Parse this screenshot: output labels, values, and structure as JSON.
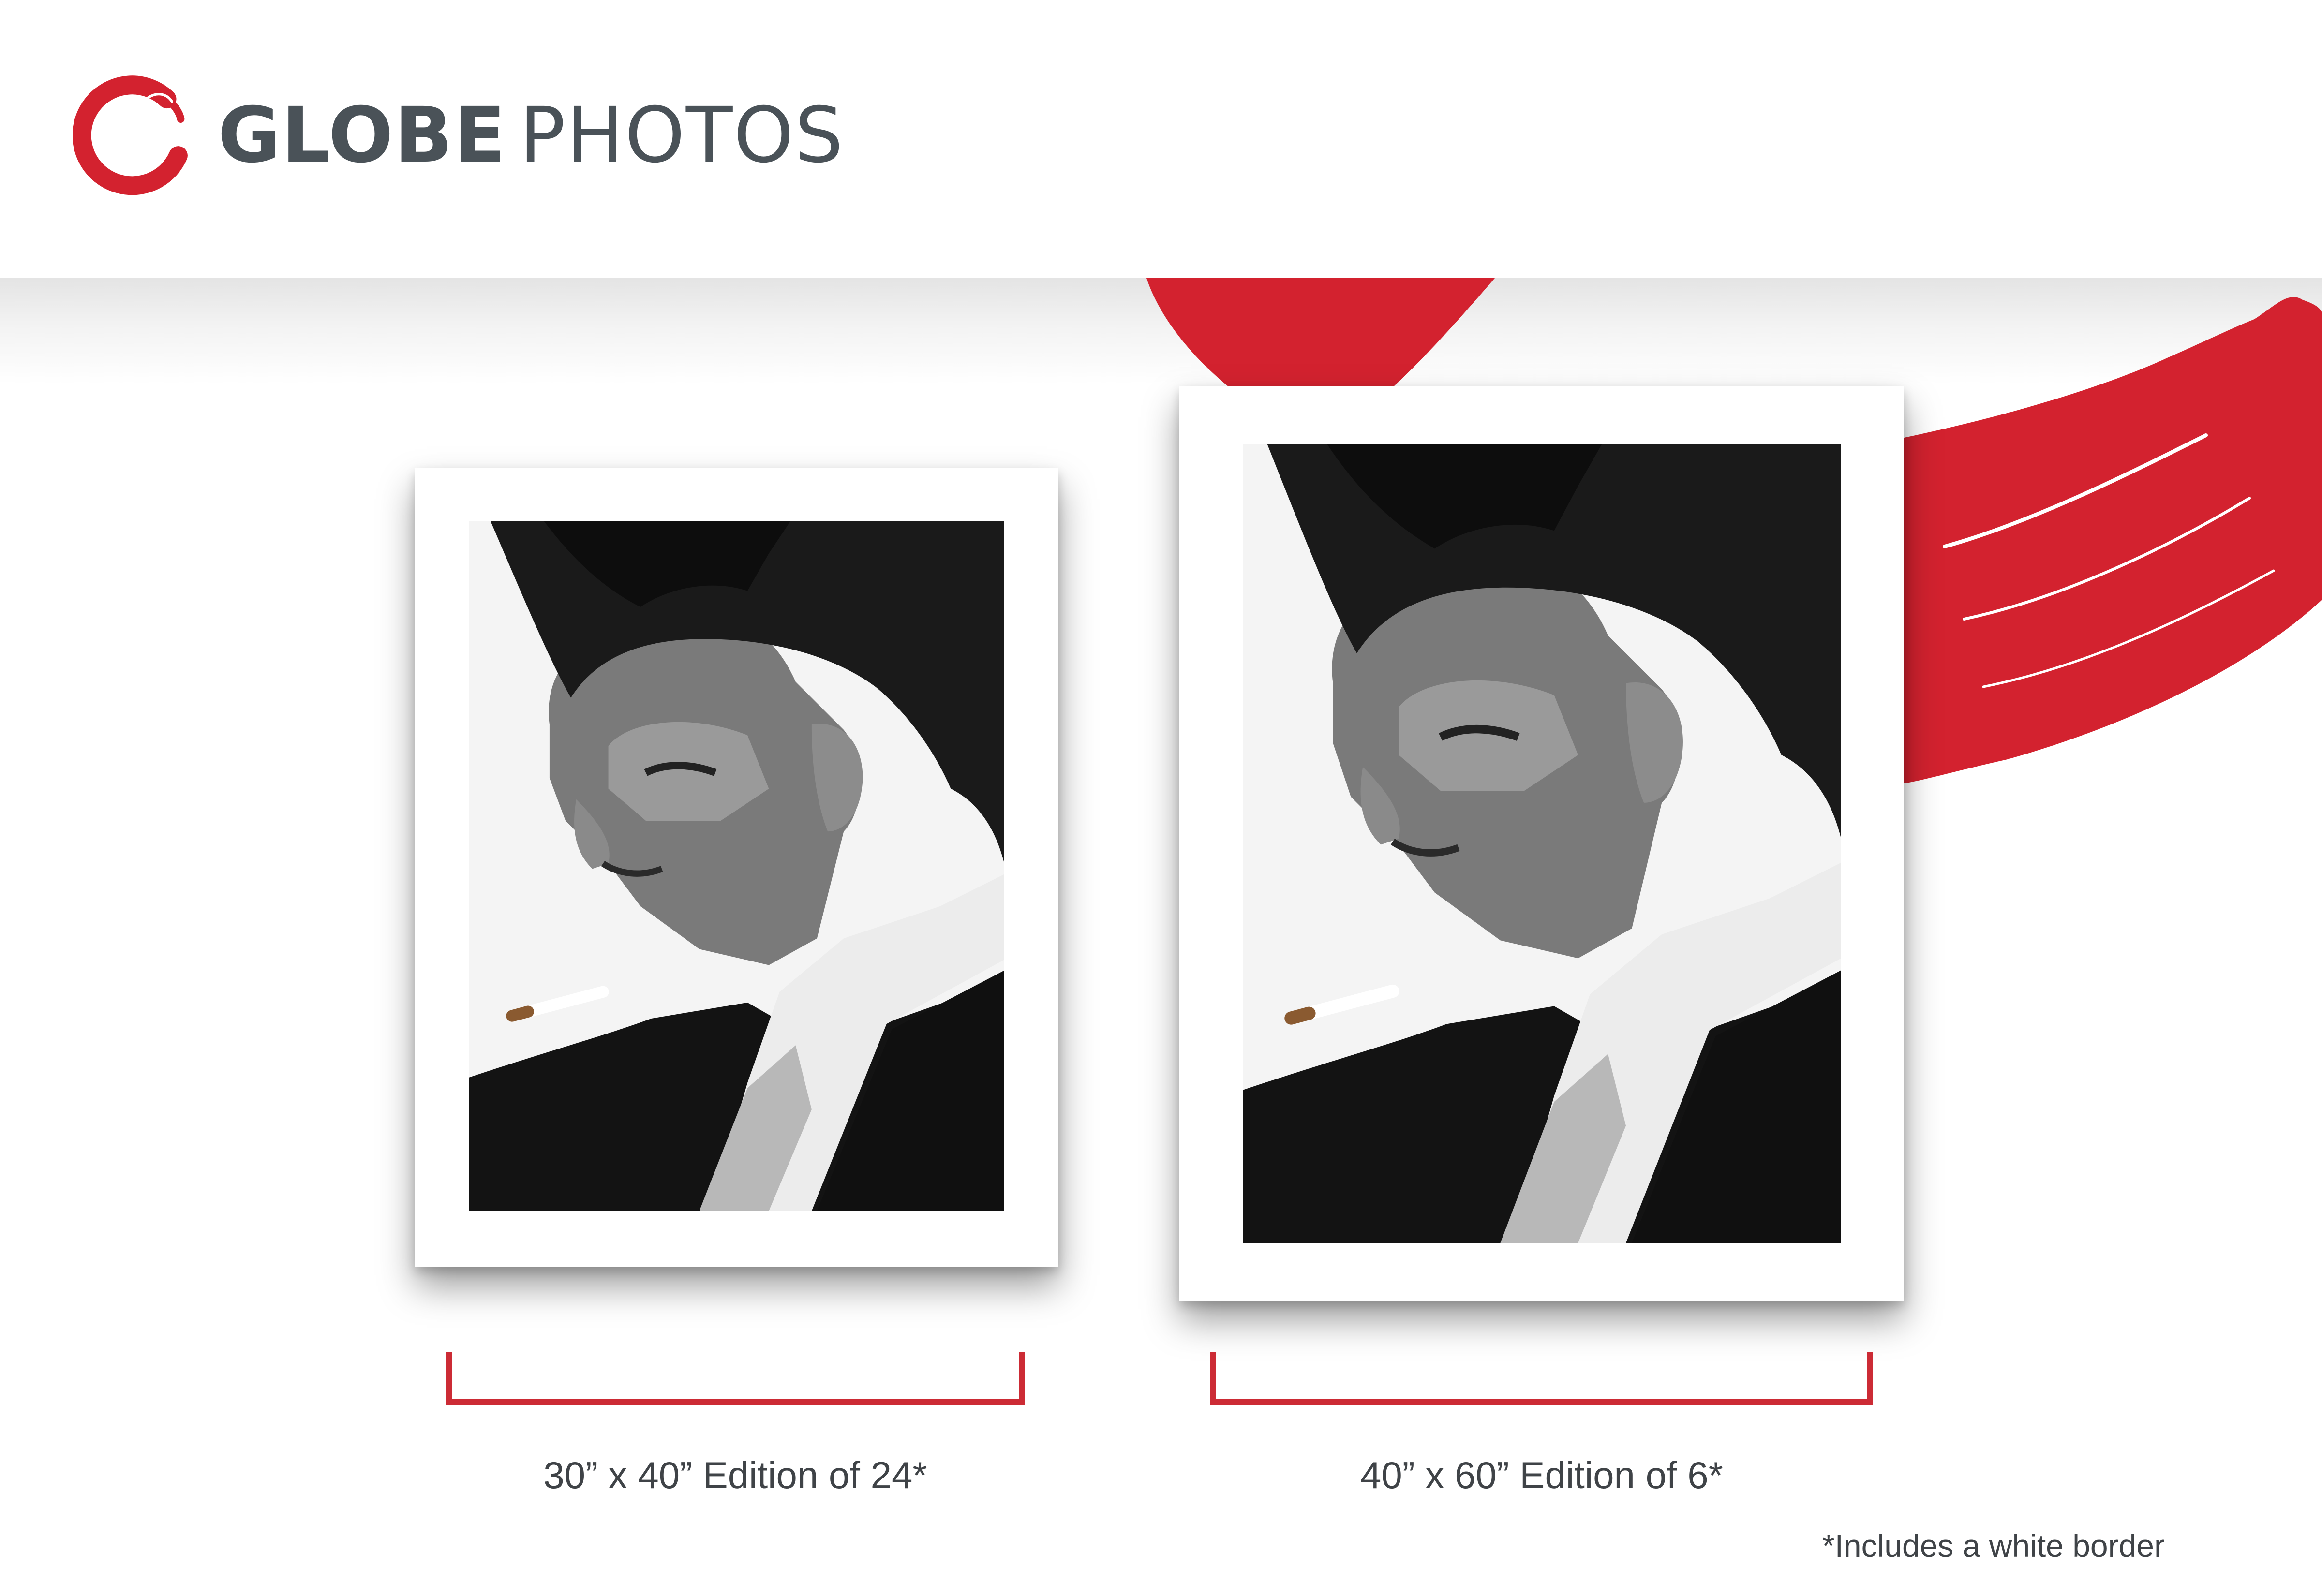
{
  "brand": {
    "logo_icon": "globe-brush-circle",
    "name_bold": "GLOBE",
    "name_light": "PHOTOS",
    "colors": {
      "accent": "#d3222f",
      "text": "#4a5258"
    }
  },
  "prints": [
    {
      "id": "small",
      "edition_label": "30” x 40” Edition of 24*"
    },
    {
      "id": "large",
      "edition_label": "40” x 60” Edition of 6*"
    }
  ],
  "footnote": "*Includes a white border",
  "bracket_color": "#cc2b35"
}
